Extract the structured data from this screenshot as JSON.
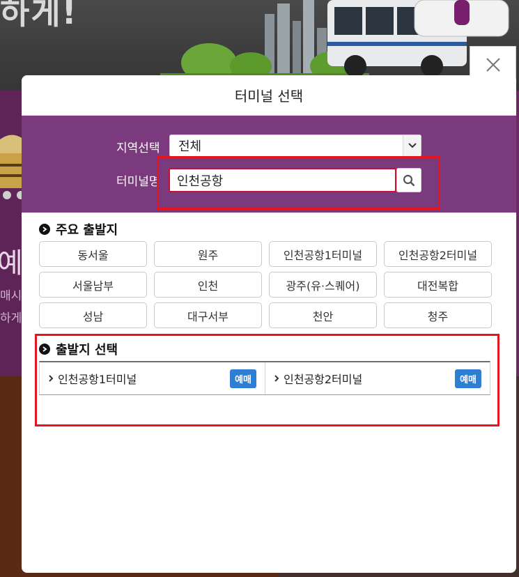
{
  "background": {
    "headline": "하게!",
    "side_big": "예",
    "side_small": [
      "매시",
      "하게"
    ]
  },
  "modal": {
    "title": "터미널 선택",
    "close_icon": "close-icon",
    "filter": {
      "region_label": "지역선택",
      "region_value": "전체",
      "terminal_label": "터미널명",
      "terminal_value": "인천공항"
    },
    "major": {
      "heading": "주요 출발지",
      "items": [
        "동서울",
        "원주",
        "인천공항1터미널",
        "인천공항2터미널",
        "서울남부",
        "인천",
        "광주(유·스퀘어)",
        "대전복합",
        "성남",
        "대구서부",
        "천안",
        "청주"
      ]
    },
    "departure": {
      "heading": "출발지 선택",
      "results": [
        {
          "name": "인천공항1터미널",
          "badge": "예매"
        },
        {
          "name": "인천공항2터미널",
          "badge": "예매"
        }
      ]
    }
  },
  "colors": {
    "purple": "#7a3a7d",
    "highlight_red": "#e4151c",
    "badge_blue": "#2e7ed4"
  }
}
